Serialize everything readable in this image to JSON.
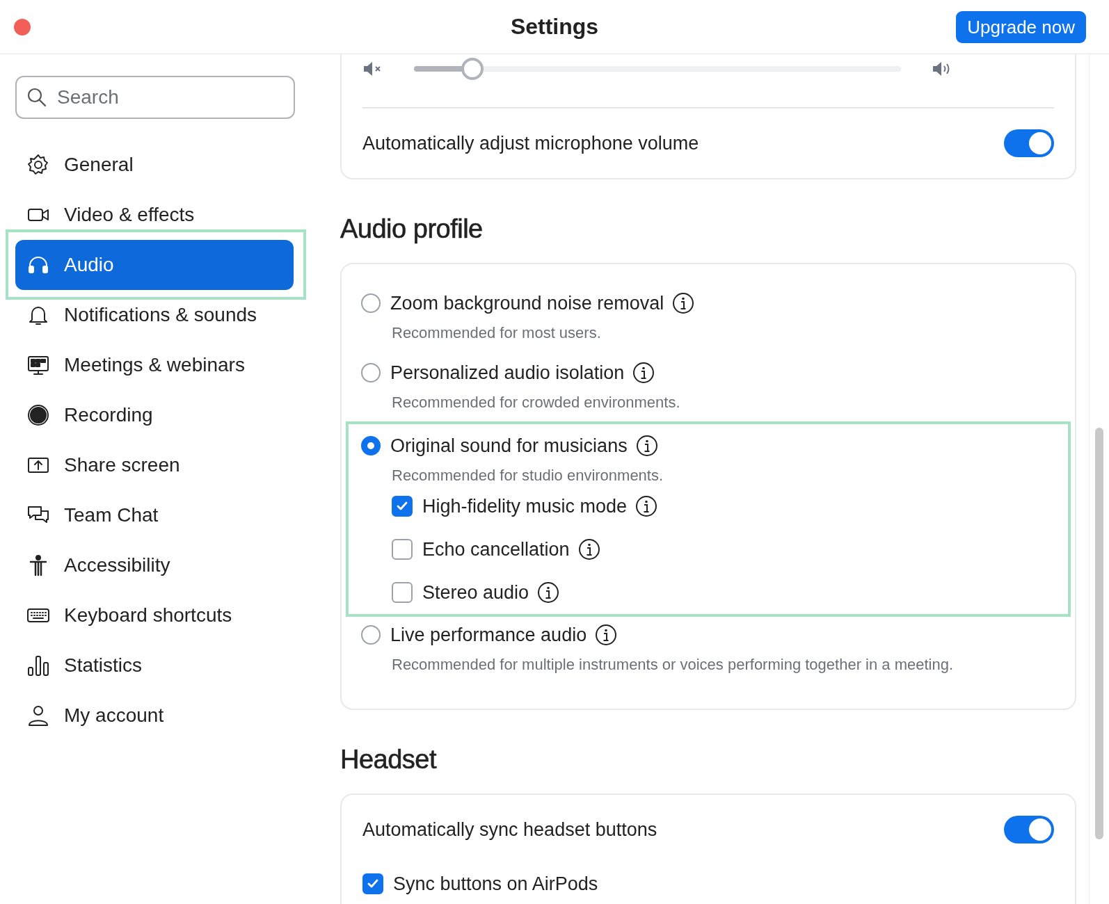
{
  "window": {
    "title": "Settings",
    "upgrade_button": "Upgrade now"
  },
  "search": {
    "placeholder": "Search"
  },
  "sidebar": {
    "items": [
      {
        "label": "General",
        "selected": false,
        "highlighted": false
      },
      {
        "label": "Video & effects",
        "selected": false,
        "highlighted": false
      },
      {
        "label": "Audio",
        "selected": true,
        "highlighted": true
      },
      {
        "label": "Notifications & sounds",
        "selected": false,
        "highlighted": false
      },
      {
        "label": "Meetings & webinars",
        "selected": false,
        "highlighted": false
      },
      {
        "label": "Recording",
        "selected": false,
        "highlighted": false
      },
      {
        "label": "Share screen",
        "selected": false,
        "highlighted": false
      },
      {
        "label": "Team Chat",
        "selected": false,
        "highlighted": false
      },
      {
        "label": "Accessibility",
        "selected": false,
        "highlighted": false
      },
      {
        "label": "Keyboard shortcuts",
        "selected": false,
        "highlighted": false
      },
      {
        "label": "Statistics",
        "selected": false,
        "highlighted": false
      },
      {
        "label": "My account",
        "selected": false,
        "highlighted": false
      }
    ]
  },
  "microphone": {
    "volume": {
      "level": 0.12
    },
    "auto_adjust": {
      "label": "Automatically adjust microphone volume",
      "on": true
    }
  },
  "audio_profile": {
    "title": "Audio profile",
    "options": [
      {
        "label": "Zoom background noise removal",
        "description": "Recommended for most users.",
        "selected": false,
        "highlighted": false
      },
      {
        "label": "Personalized audio isolation",
        "description": "Recommended for crowded environments.",
        "selected": false,
        "highlighted": false
      },
      {
        "label": "Original sound for musicians",
        "description": "Recommended for studio environments.",
        "selected": true,
        "highlighted": true,
        "sub_options": [
          {
            "label": "High-fidelity music mode",
            "checked": true
          },
          {
            "label": "Echo cancellation",
            "checked": false
          },
          {
            "label": "Stereo audio",
            "checked": false
          }
        ]
      },
      {
        "label": "Live performance audio",
        "description": "Recommended for multiple instruments or voices performing together in a meeting.",
        "selected": false,
        "highlighted": false
      }
    ]
  },
  "headset": {
    "title": "Headset",
    "sync_buttons": {
      "label": "Automatically sync headset buttons",
      "on": true
    },
    "airpods": {
      "label": "Sync buttons on AirPods",
      "checked": true
    }
  }
}
